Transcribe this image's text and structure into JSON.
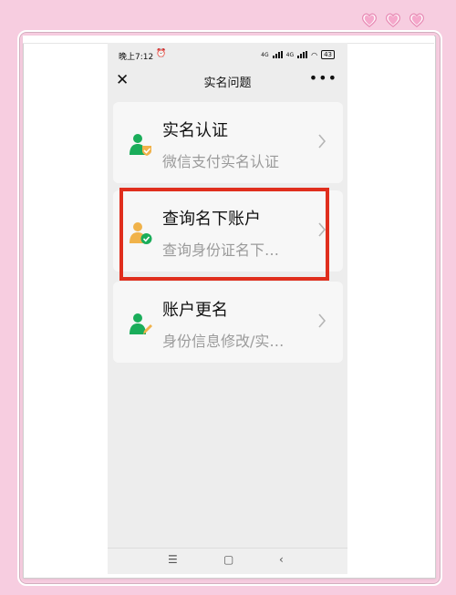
{
  "status": {
    "time": "晚上7:12",
    "net1": "4G",
    "net2": "4G",
    "battery": "43"
  },
  "nav": {
    "title": "实名问题"
  },
  "cards": [
    {
      "title": "实名认证",
      "subtitle": "微信支付实名认证",
      "icon": "person-verified-icon"
    },
    {
      "title": "查询名下账户",
      "subtitle": "查询身份证名下…",
      "icon": "person-check-icon"
    },
    {
      "title": "账户更名",
      "subtitle": "身份信息修改/实…",
      "icon": "person-edit-icon"
    }
  ],
  "colors": {
    "highlight": "#e02e1d",
    "green": "#1aad5a",
    "orange": "#f0b24a",
    "background": "#f7cde0"
  }
}
